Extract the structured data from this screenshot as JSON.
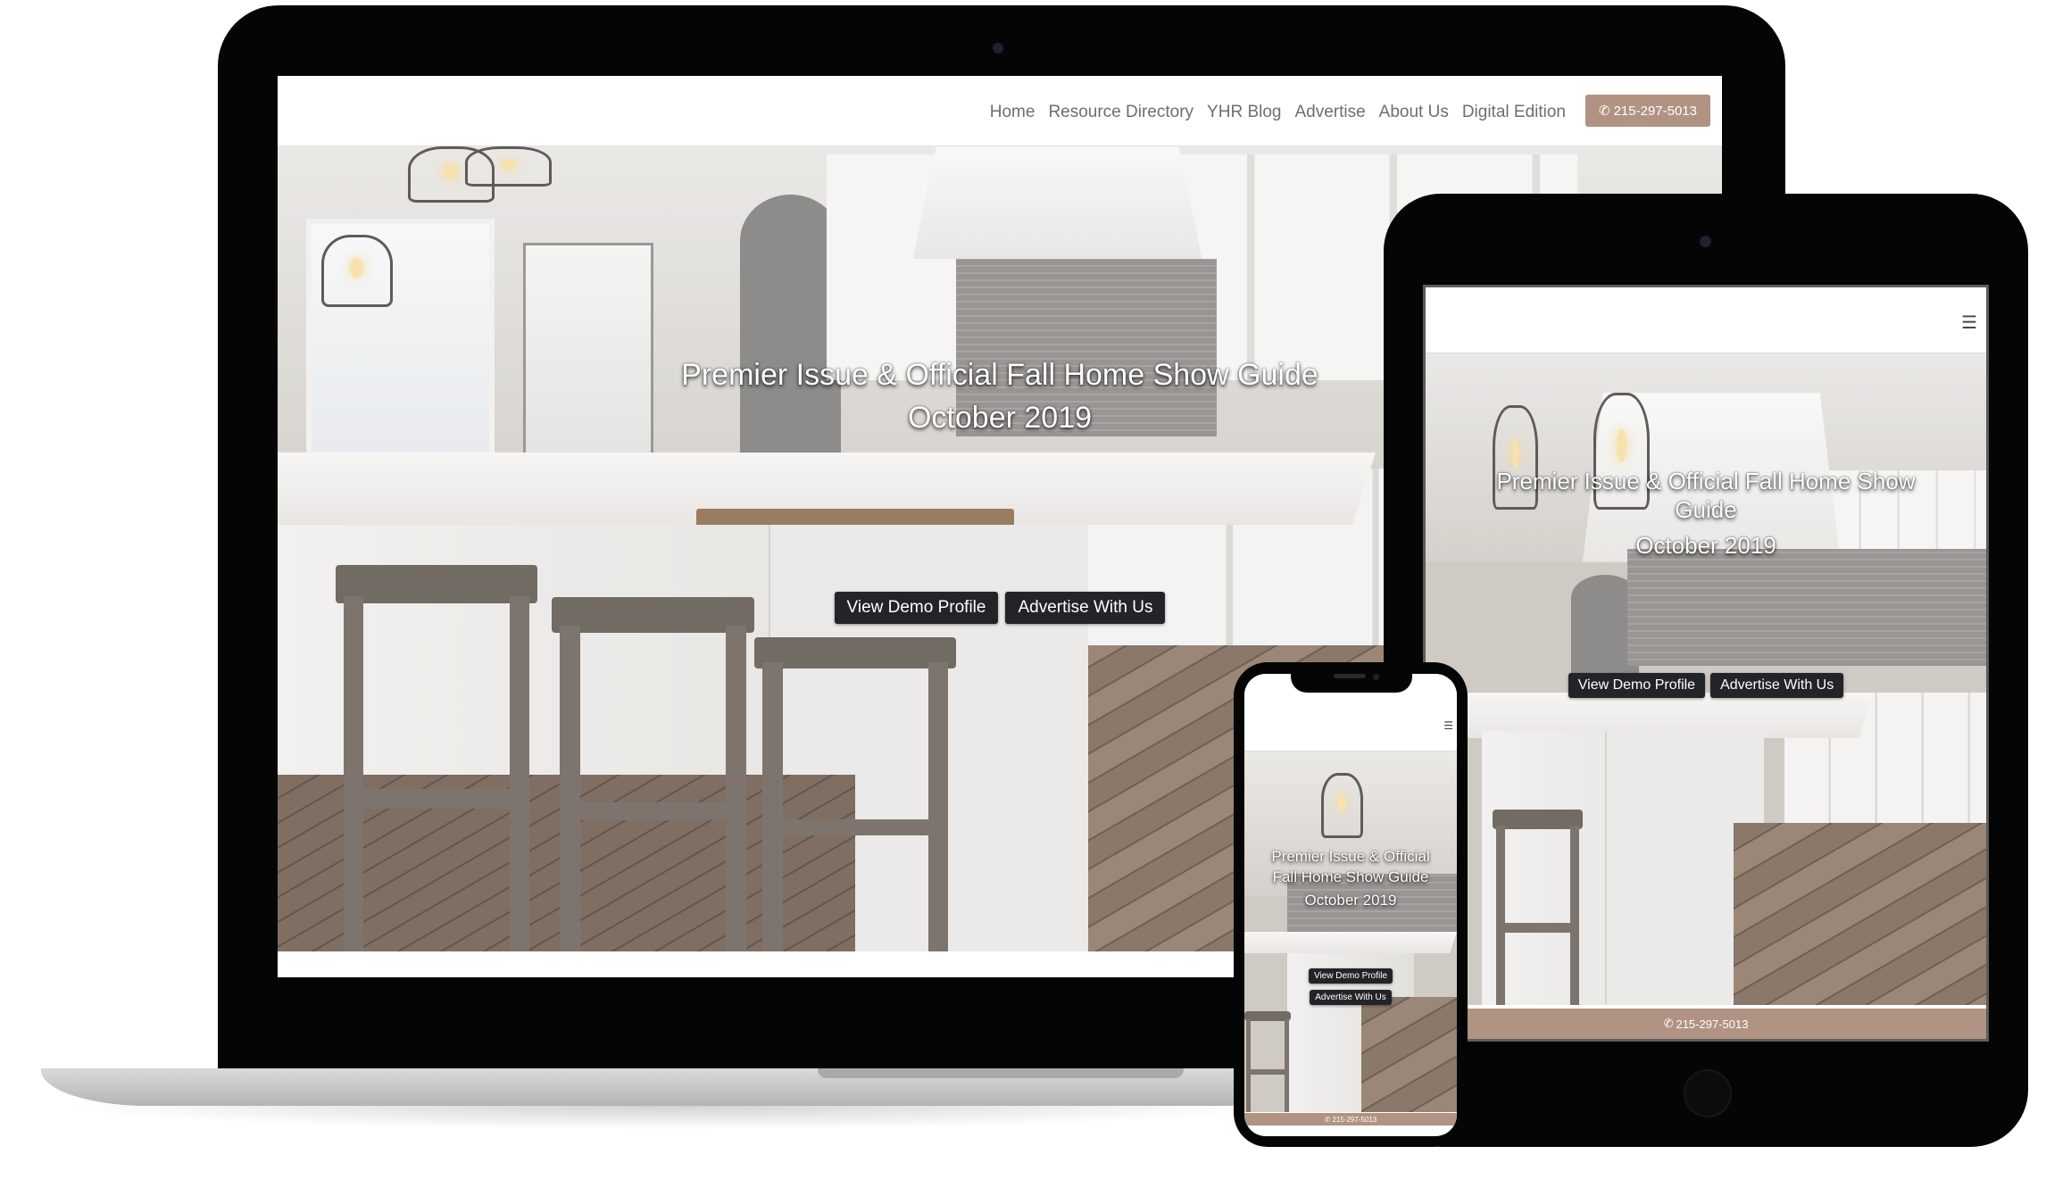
{
  "site": {
    "nav": [
      "Home",
      "Resource Directory",
      "YHR Blog",
      "Advertise",
      "About Us",
      "Digital Edition"
    ],
    "phone": "215-297-5013",
    "menu_icon": "hamburger-icon",
    "phone_icon": "phone-icon"
  },
  "hero": {
    "title": "Premier Issue & Official Fall Home Show Guide",
    "title_tablet_line1": "Premier Issue & Official Fall Home Show",
    "title_tablet_line2": "Guide",
    "title_phone_line1": "Premier Issue & Official",
    "title_phone_line2": "Fall Home Show Guide",
    "subtitle": "October 2019",
    "buttons": [
      "View Demo Profile",
      "Advertise With Us"
    ]
  },
  "colors": {
    "accent": "#b09382",
    "button_dark": "#222427",
    "nav_text": "#6e6e6e",
    "device_frame": "#050505"
  }
}
